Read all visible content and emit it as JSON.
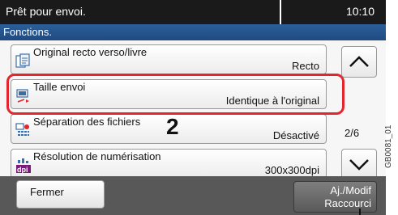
{
  "status": {
    "message": "Prêt pour envoi.",
    "time": "10:10"
  },
  "header": {
    "title": "Fonctions."
  },
  "items": [
    {
      "label": "Original recto verso/livre",
      "value": "Recto",
      "icon": "duplex-original-icon"
    },
    {
      "label": "Taille envoi",
      "value": "Identique à l'original",
      "icon": "send-size-icon"
    },
    {
      "label": "Séparation des fichiers",
      "value": "Désactivé",
      "icon": "file-separation-icon"
    },
    {
      "label": "Résolution de numérisation",
      "value": "300x300dpi",
      "icon": "dpi-icon"
    }
  ],
  "pagination": {
    "page": "2/6",
    "up_icon": "chevron-up-icon",
    "down_icon": "chevron-down-icon"
  },
  "footer": {
    "close_label": "Fermer",
    "shortcut_line1": "Aj./Modif",
    "shortcut_line2": "Raccourci"
  },
  "annotation": {
    "callout": "2",
    "code": "GB0081_01"
  },
  "colors": {
    "highlight": "#e3262e",
    "header": "#2c5f9a",
    "status_bar": "#1a1a1a",
    "bottom_bar": "#585858"
  }
}
